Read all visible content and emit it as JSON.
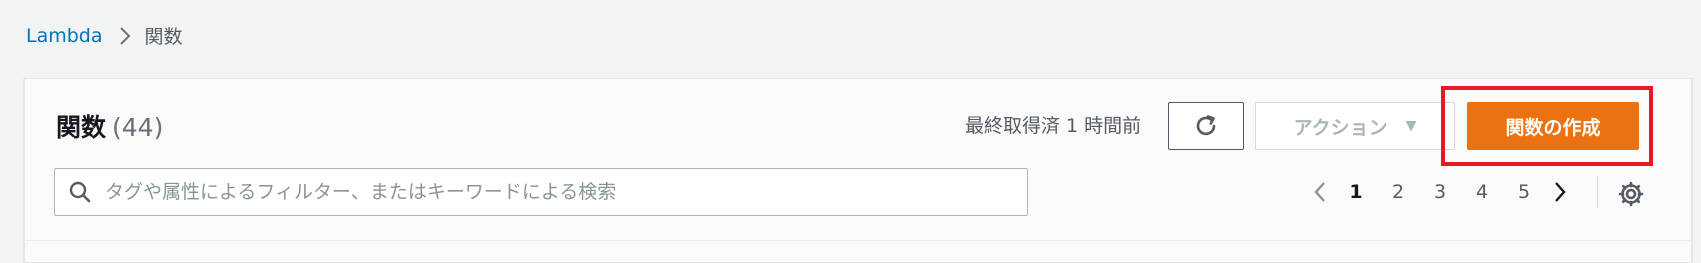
{
  "breadcrumb": {
    "root": "Lambda",
    "current": "関数"
  },
  "header": {
    "title": "関数",
    "count": "(44)",
    "last_fetched": "最終取得済 1 時間前",
    "actions_label": "アクション",
    "create_label": "関数の作成"
  },
  "search": {
    "placeholder": "タグや属性によるフィルター、またはキーワードによる検索"
  },
  "pagination": {
    "pages": [
      "1",
      "2",
      "3",
      "4",
      "5"
    ],
    "current": "1"
  },
  "colors": {
    "primary_button": "#ec7211",
    "link": "#0073bb",
    "highlight": "#e31b23"
  },
  "icons": {
    "breadcrumb_separator": "chevron-right-icon",
    "refresh": "refresh-icon",
    "actions_caret": "caret-down-icon",
    "search": "search-icon",
    "prev": "chevron-left-icon",
    "next": "chevron-right-icon",
    "settings": "gear-icon"
  }
}
